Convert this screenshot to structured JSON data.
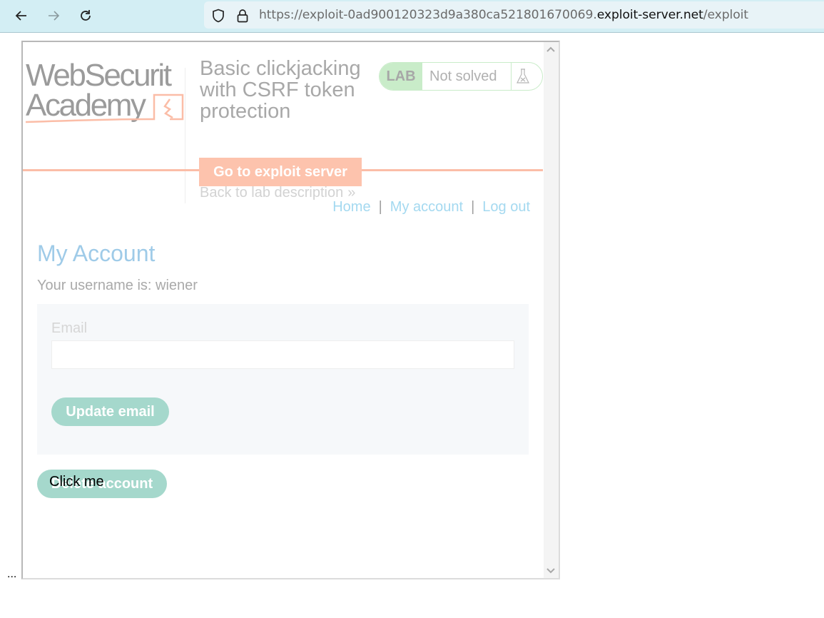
{
  "browser": {
    "url_prefix": "https://exploit-0ad900120323d9a380ca521801670069.",
    "url_host": "exploit-server.net",
    "url_path": "/exploit",
    "icons": [
      "back-arrow-icon",
      "forward-arrow-icon",
      "reload-icon",
      "shield-icon",
      "lock-icon"
    ]
  },
  "lab": {
    "logo_line1": "WebSecurit",
    "logo_line2": "Academy",
    "title": "Basic clickjacking with CSRF token protection",
    "badge_tag": "LAB",
    "status": "Not solved",
    "exploit_button": "Go to exploit server",
    "back_link": "Back to lab description",
    "back_chevron": "»",
    "colors": {
      "accent_orange": "#fdc3ad",
      "badge_green": "#c9ecc9",
      "button_teal": "#a5d8cc",
      "link_blue": "#a4d9f0"
    }
  },
  "nav": {
    "home": "Home",
    "separator": "|",
    "my_account": "My account",
    "log_out": "Log out"
  },
  "account": {
    "heading": "My Account",
    "username_text": "Your username is: wiener",
    "email_label": "Email",
    "email_value": "",
    "update_button": "Update email",
    "delete_button": "Delete account"
  },
  "decoy": {
    "text": "Click me"
  },
  "footer": {
    "ellipsis": "..."
  }
}
